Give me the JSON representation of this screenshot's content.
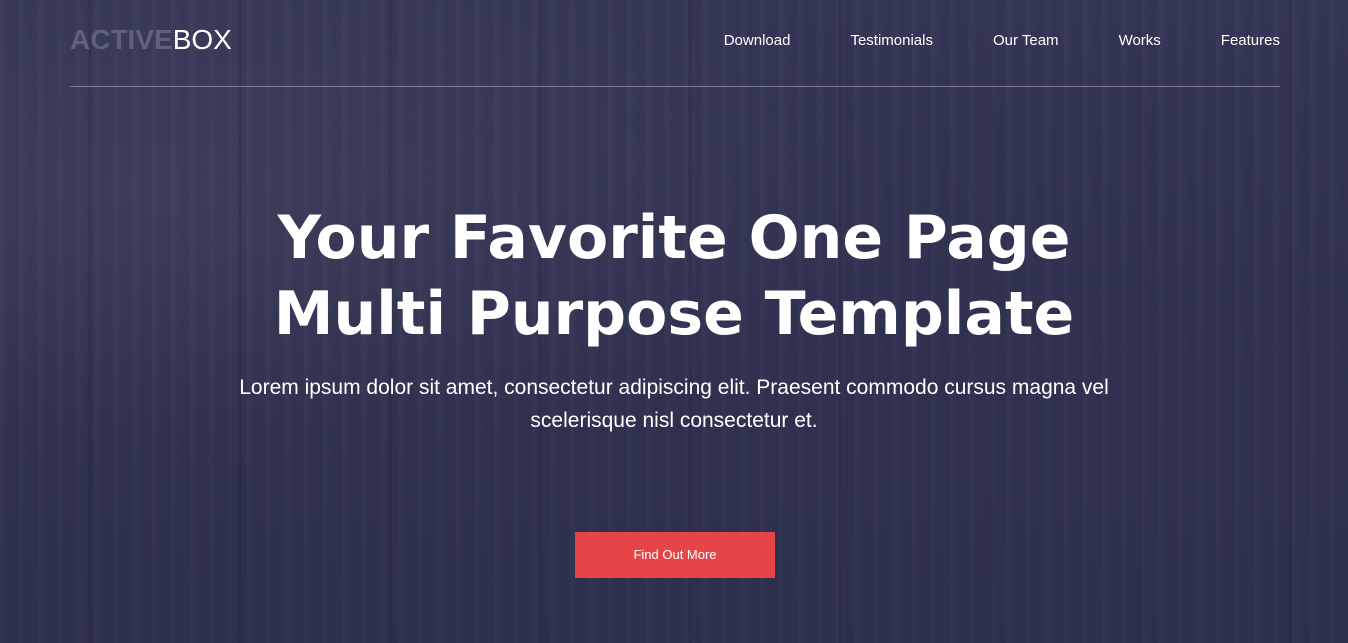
{
  "brand": {
    "strong": "ACTIVE",
    "light": "BOX"
  },
  "nav": {
    "items": [
      {
        "label": "Download"
      },
      {
        "label": "Testimonials"
      },
      {
        "label": "Our Team"
      },
      {
        "label": "Works"
      },
      {
        "label": "Features"
      }
    ]
  },
  "hero": {
    "headline_line1": "Your Favorite One Page",
    "headline_line2": "Multi Purpose Template",
    "subtitle": "Lorem ipsum dolor sit amet, consectetur adipiscing elit. Praesent commodo cursus magna vel scelerisque nisl consectetur et.",
    "cta_label": "Find Out More"
  },
  "colors": {
    "background": "#2f3150",
    "accent": "#e74447",
    "logo_dim": "#5d6080",
    "text": "#ffffff"
  }
}
